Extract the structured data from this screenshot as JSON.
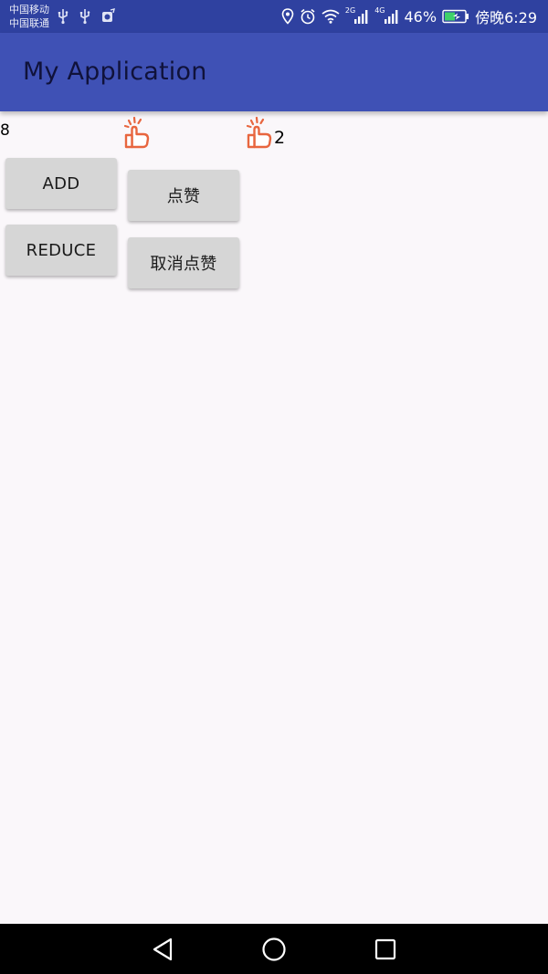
{
  "status_bar": {
    "carrier_1": "中国移动",
    "carrier_2": "中国联通",
    "network_1": "2G",
    "network_2": "4G",
    "battery": "46%",
    "time": "傍晚6:29"
  },
  "app_bar": {
    "title": "My Application"
  },
  "main": {
    "count": "8",
    "like_count": "2",
    "add_label": "ADD",
    "reduce_label": "REDUCE",
    "like_label": "点赞",
    "unlike_label": "取消点赞"
  },
  "icons": {
    "thumb": "thumb-up-icon",
    "back": "back-triangle-icon",
    "home": "home-circle-icon",
    "recents": "recents-square-icon"
  },
  "colors": {
    "status_bar": "#2f41a0",
    "app_bar": "#3f51b5",
    "thumb_icon": "#e8663f",
    "button": "#d6d6d6",
    "background": "#faf7fa"
  }
}
